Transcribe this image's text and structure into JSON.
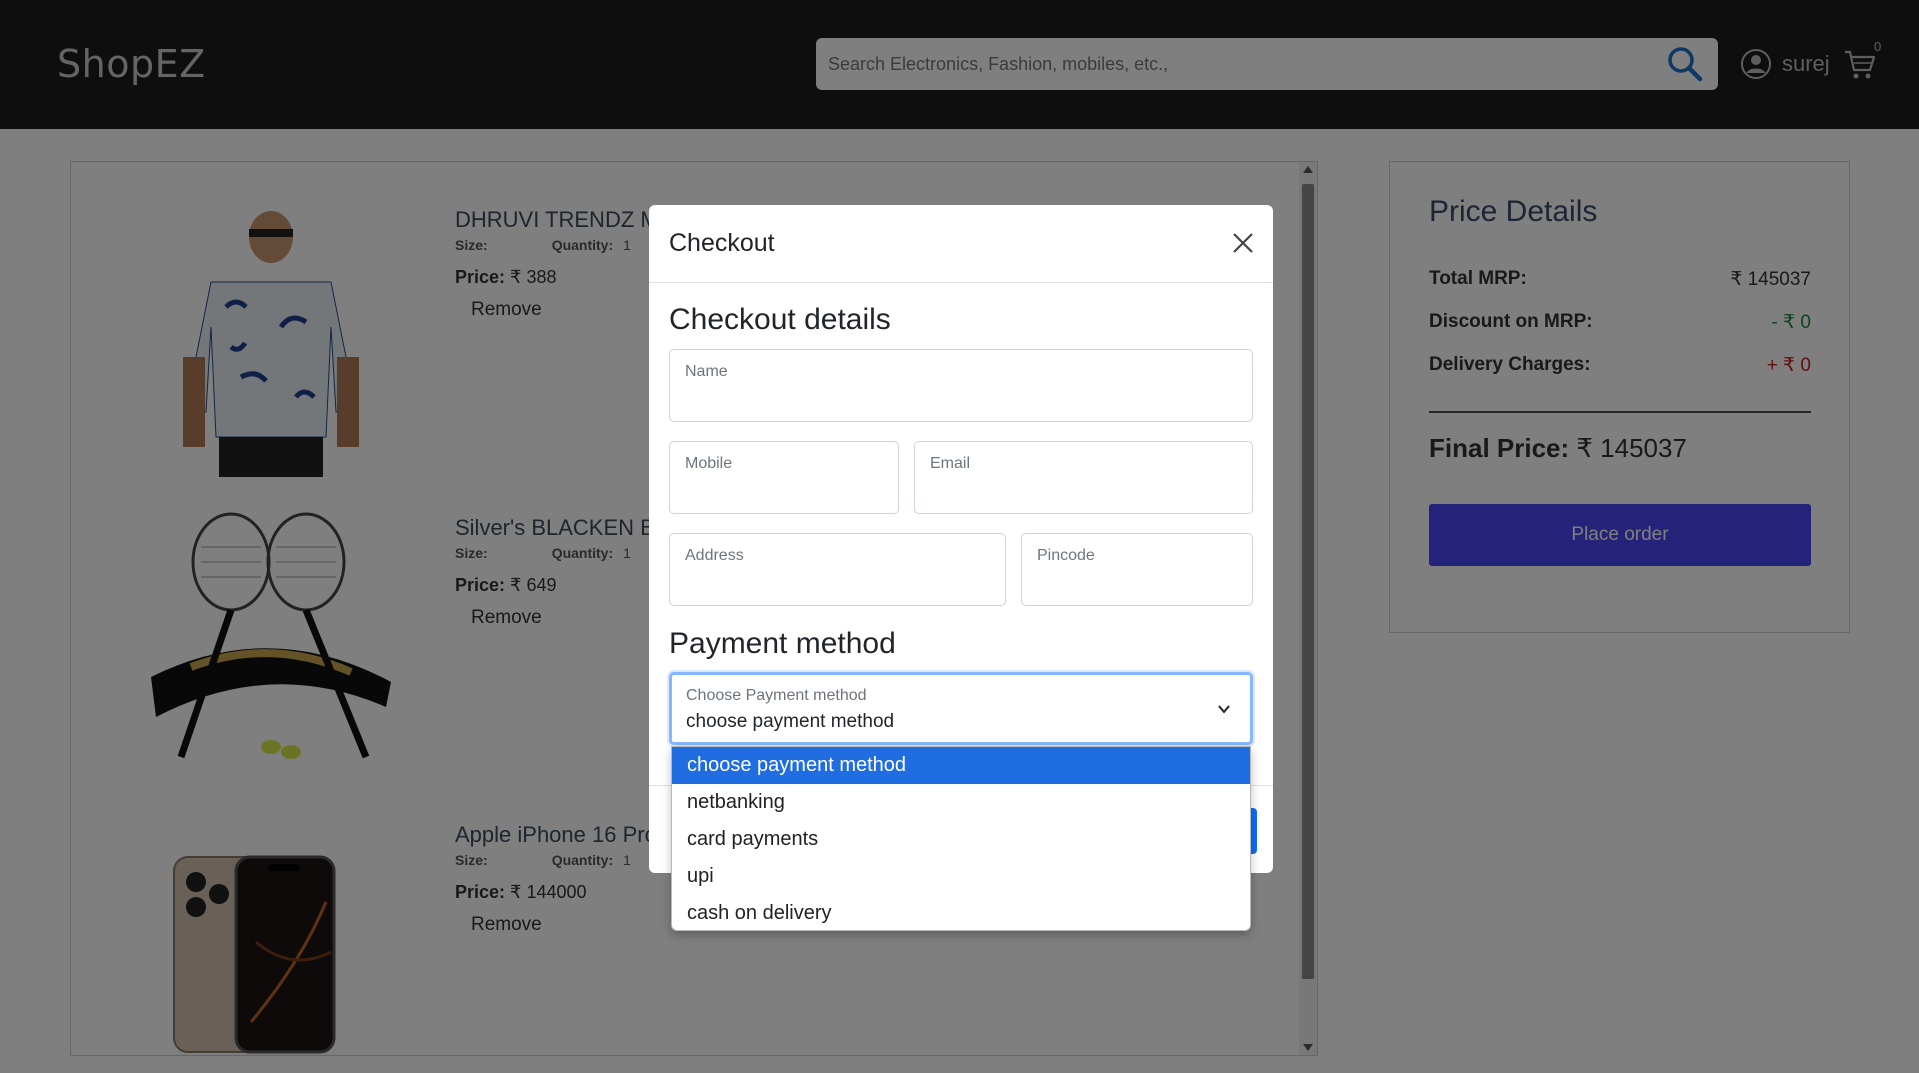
{
  "navbar": {
    "brand": "ShopEZ",
    "search_placeholder": "Search Electronics, Fashion, mobiles, etc.,",
    "user_name": "surej",
    "cart_count": "0",
    "icons": [
      "search-icon",
      "user-circle-icon",
      "cart-icon"
    ]
  },
  "cart": {
    "items": [
      {
        "title": "DHRUVI TRENDZ M",
        "size_label": "Size:",
        "qty_label": "Quantity:",
        "qty": "1",
        "price_label": "Price:",
        "price": "₹ 388",
        "remove": "Remove"
      },
      {
        "title": "Silver's BLACKEN Ba",
        "size_label": "Size:",
        "qty_label": "Quantity:",
        "qty": "1",
        "price_label": "Price:",
        "price": "₹ 649",
        "remove": "Remove"
      },
      {
        "title": "Apple iPhone 16 Pro",
        "size_label": "Size:",
        "qty_label": "Quantity:",
        "qty": "1",
        "price_label": "Price:",
        "price": "₹ 144000",
        "remove": "Remove"
      }
    ]
  },
  "price_details": {
    "title": "Price Details",
    "total_mrp_label": "Total MRP:",
    "total_mrp": "₹ 145037",
    "discount_label": "Discount on MRP:",
    "discount": "- ₹ 0",
    "delivery_label": "Delivery Charges:",
    "delivery": "+ ₹ 0",
    "final_label": "Final Price:",
    "final_value": "₹ 145037",
    "place_order": "Place order",
    "colors": {
      "discount": "#1a8a3a",
      "delivery": "#c0201f",
      "button": "#4b44f5"
    }
  },
  "modal": {
    "title": "Checkout",
    "details_heading": "Checkout details",
    "fields": {
      "name": "Name",
      "mobile": "Mobile",
      "email": "Email",
      "address": "Address",
      "pincode": "Pincode"
    },
    "payment_heading": "Payment method",
    "payment_label": "Choose Payment method",
    "payment_selected": "choose payment method",
    "payment_options": [
      "choose payment method",
      "netbanking",
      "card payments",
      "upi",
      "cash on delivery"
    ]
  }
}
